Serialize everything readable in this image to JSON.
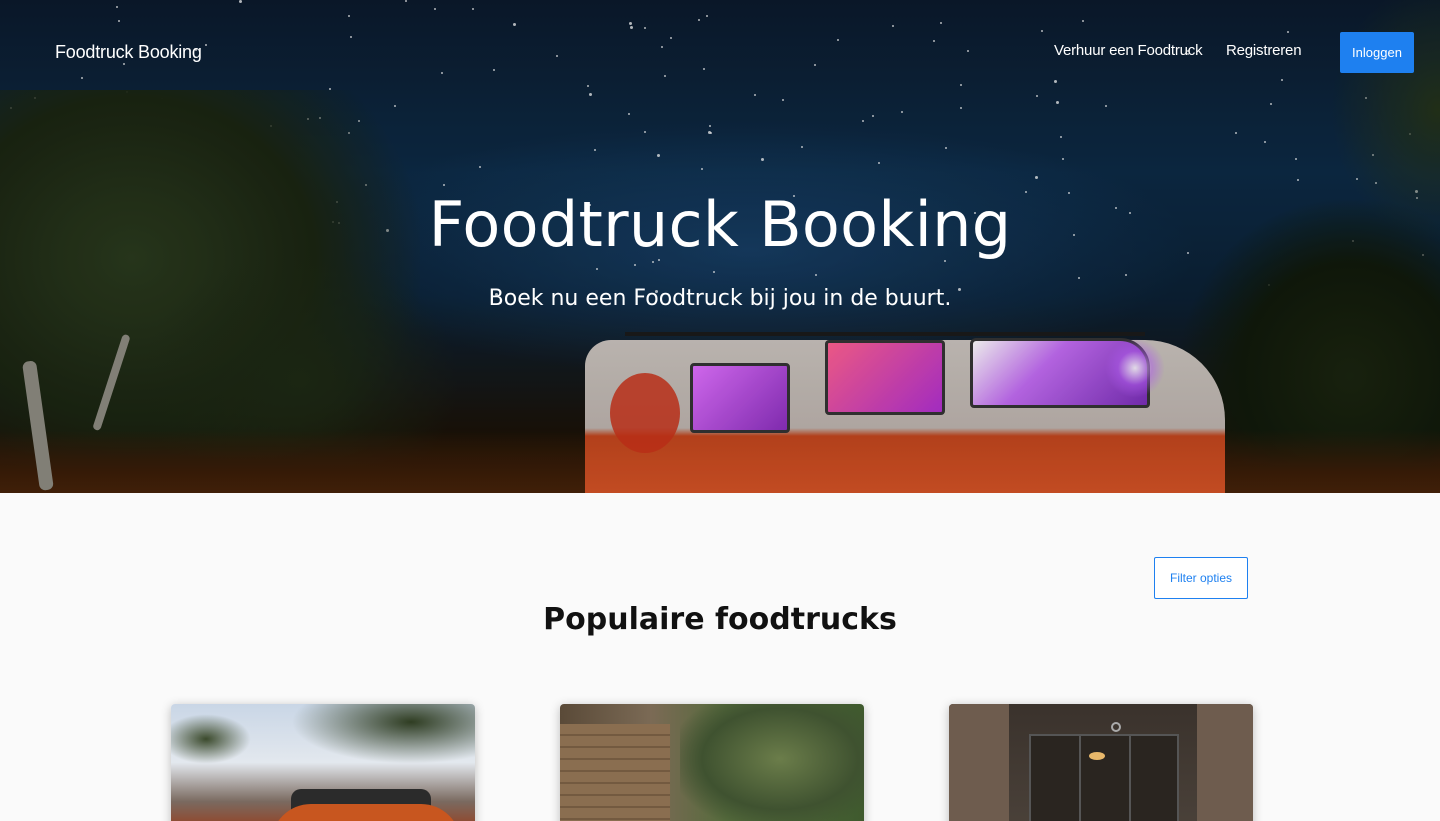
{
  "nav": {
    "brand": "Foodtruck Booking",
    "links": [
      {
        "label": "Verhuur een Foodtruck"
      },
      {
        "label": "Registreren"
      }
    ],
    "login_label": "Inloggen"
  },
  "hero": {
    "title": "Foodtruck Booking",
    "subtitle": "Boek nu een Foodtruck bij jou in de buurt."
  },
  "main": {
    "filter_label": "Filter opties",
    "section_title": "Populaire foodtrucks",
    "cards": [
      {
        "image": "foodtruck-photo-1"
      },
      {
        "image": "foodtruck-photo-2"
      },
      {
        "image": "foodtruck-photo-3"
      }
    ]
  },
  "colors": {
    "accent": "#1e80f0",
    "page_background": "#fafafa",
    "hero_text": "#ffffff"
  }
}
